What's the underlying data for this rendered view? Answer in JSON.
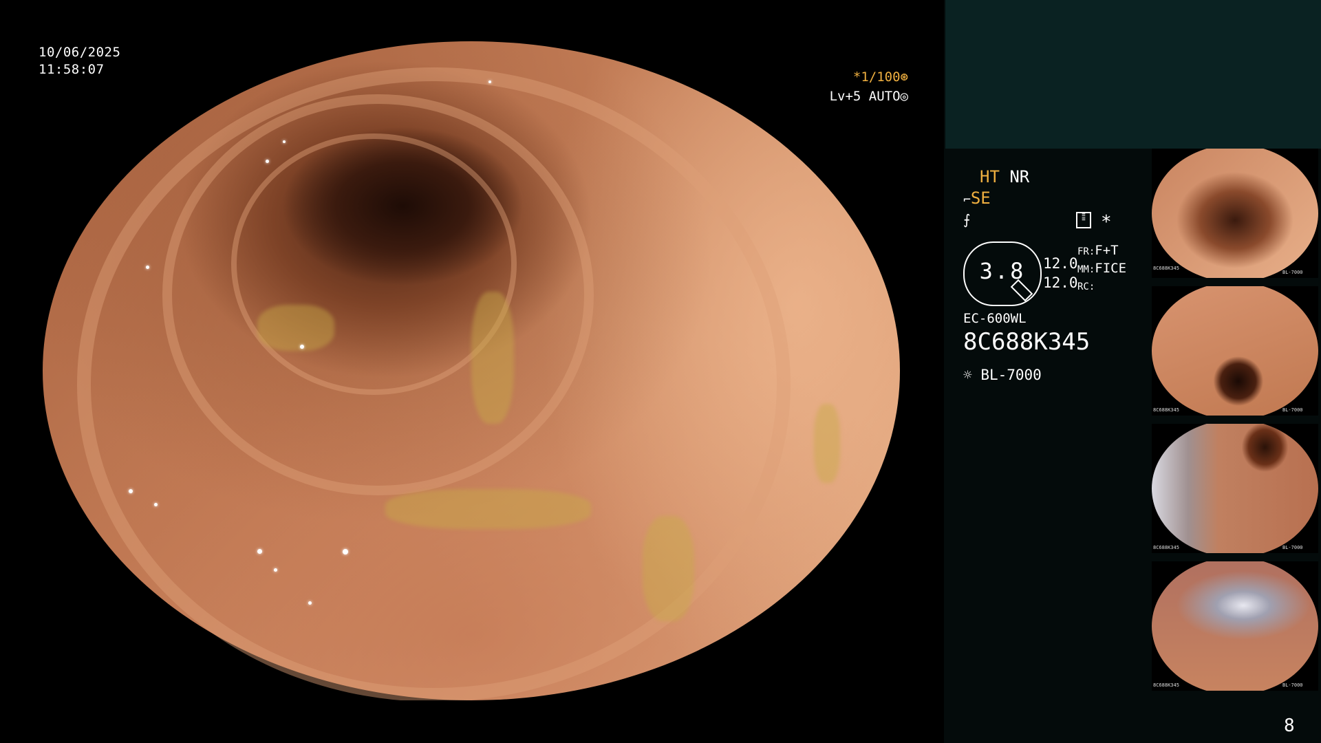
{
  "display": {
    "date": "10/06/2025",
    "time": "11:58:07"
  },
  "video_overlay": {
    "shutter": "*1/100",
    "level": "Lv+5",
    "mode": "AUTO"
  },
  "panel": {
    "ht": "HT",
    "nr": "NR",
    "se": "SE",
    "asterisk": "*",
    "scope_value": "3.8",
    "val1": "12.0",
    "val2": "12.0",
    "fr_label": "FR:",
    "fr_value": "F+T",
    "mm_label": "MM:",
    "mm_value": "FICE",
    "rc_label": "RC:",
    "scope_model": "EC-600WL",
    "serial": "8C688K345",
    "light_source": "BL-7000"
  },
  "thumbnails": [
    {
      "serial": "8C688K345",
      "light": "BL-7000"
    },
    {
      "serial": "8C688K345",
      "light": "BL-7000"
    },
    {
      "serial": "8C688K345",
      "light": "BL-7000"
    },
    {
      "serial": "8C688K345",
      "light": "BL-7000"
    }
  ],
  "page_number": "8",
  "colors": {
    "accent_amber": "#f0b040",
    "panel_bg": "#040b0b",
    "panel_top_bg": "#0a2222"
  }
}
